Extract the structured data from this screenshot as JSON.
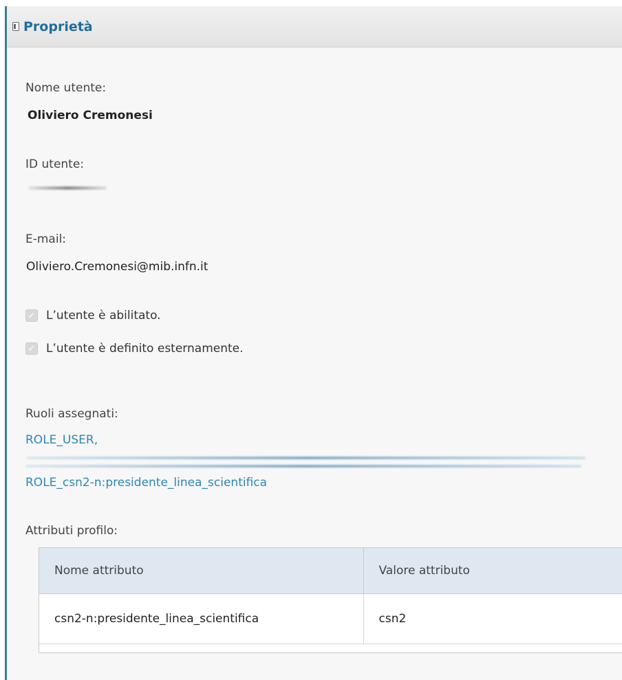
{
  "panel": {
    "title": "Proprietà",
    "icon": "panel-collapse-icon"
  },
  "user": {
    "name_label": "Nome utente:",
    "name_value": "Oliviero Cremonesi",
    "id_label": "ID utente:",
    "email_label": "E-mail:",
    "email_value": "Oliviero.Cremonesi@mib.infn.it"
  },
  "flags": {
    "enabled_label": "L’utente è abilitato.",
    "enabled_checked": true,
    "external_label": "L’utente è definito esternamente.",
    "external_checked": true
  },
  "roles": {
    "label": "Ruoli assegnati:",
    "items": [
      "ROLE_USER,",
      "ROLE_csn2-n:presidente_linea_scientifica"
    ]
  },
  "attributes": {
    "label": "Attributi profilo:",
    "columns": [
      "Nome attributo",
      "Valore attributo"
    ],
    "rows": [
      [
        "csn2-n:presidente_linea_scientifica",
        "csn2"
      ]
    ]
  },
  "colors": {
    "accent": "#1f6d9d",
    "link": "#2a87b7",
    "left_border": "#3b7d93",
    "table_header": "#dfe8f1"
  }
}
